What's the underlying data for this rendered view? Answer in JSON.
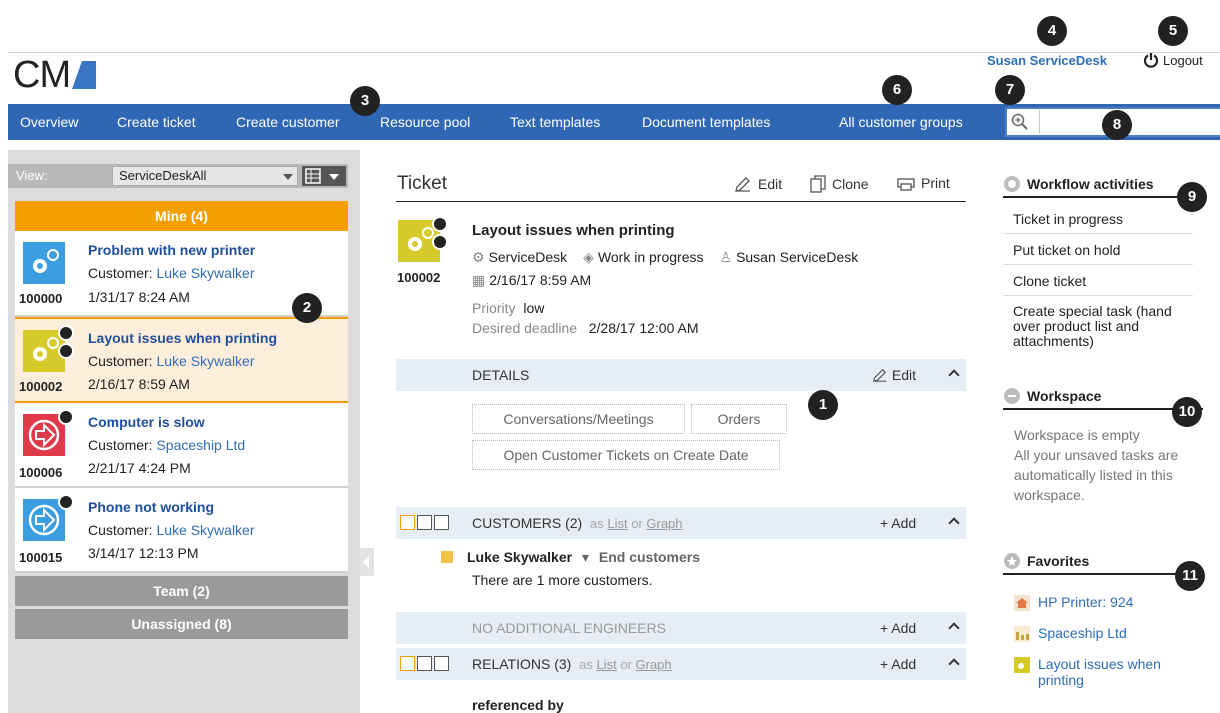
{
  "app": {
    "logo_text": "CM"
  },
  "header": {
    "user_name": "Susan ServiceDesk",
    "logout_label": "Logout"
  },
  "nav": {
    "items": [
      {
        "label": "Overview"
      },
      {
        "label": "Create ticket"
      },
      {
        "label": "Create customer"
      },
      {
        "label": "Resource pool"
      },
      {
        "label": "Text templates"
      },
      {
        "label": "Document templates"
      },
      {
        "label": "All customer groups"
      }
    ],
    "search_value": ""
  },
  "callouts": [
    "1",
    "2",
    "3",
    "4",
    "5",
    "6",
    "7",
    "8",
    "9",
    "10",
    "11"
  ],
  "sidebar": {
    "view_label": "View:",
    "view_value": "ServiceDeskAll",
    "mine_label": "Mine (4)",
    "team_label": "Team (2)",
    "unassigned_label": "Unassigned (8)",
    "customer_prefix": "Customer: ",
    "tickets": [
      {
        "id": "100000",
        "title": "Problem with new printer",
        "customer": "Luke Skywalker",
        "date": "1/31/17 8:24 AM"
      },
      {
        "id": "100002",
        "title": "Layout issues when printing",
        "customer": "Luke Skywalker",
        "date": "2/16/17 8:59 AM"
      },
      {
        "id": "100006",
        "title": "Computer is slow",
        "customer": "Spaceship Ltd",
        "date": "2/21/17 4:24 PM"
      },
      {
        "id": "100015",
        "title": "Phone not working",
        "customer": "Luke Skywalker",
        "date": "3/14/17 12:13 PM"
      }
    ]
  },
  "ticket": {
    "section_title": "Ticket",
    "edit_label": "Edit",
    "clone_label": "Clone",
    "print_label": "Print",
    "id": "100002",
    "title": "Layout issues when printing",
    "group": "ServiceDesk",
    "status": "Work in progress",
    "assignee": "Susan ServiceDesk",
    "created": "2/16/17 8:59 AM",
    "priority_label": "Priority",
    "priority_value": "low",
    "deadline_label": "Desired deadline",
    "deadline_value": "2/28/17 12:00 AM"
  },
  "details": {
    "title": "DETAILS",
    "edit_label": "Edit",
    "chips": [
      "Conversations/Meetings",
      "Orders",
      "Open Customer Tickets on Create Date"
    ]
  },
  "customers": {
    "title": "CUSTOMERS (2)",
    "as": "as",
    "list": "List",
    "or": "or",
    "graph": "Graph",
    "add_label": "+ Add",
    "name": "Luke Skywalker",
    "type": "End customers",
    "more": "There are 1 more customers."
  },
  "engineers": {
    "title": "NO ADDITIONAL ENGINEERS",
    "add_label": "+ Add"
  },
  "relations": {
    "title": "RELATIONS (3)",
    "as": "as",
    "list": "List",
    "or": "or",
    "graph": "Graph",
    "add_label": "+ Add",
    "referenced_by": "referenced by"
  },
  "workflow": {
    "title": "Workflow activities",
    "items": [
      "Ticket in progress",
      "Put ticket on hold",
      "Clone ticket",
      "Create special task (hand over product list and attachments)"
    ]
  },
  "workspace": {
    "title": "Workspace",
    "empty": "Workspace is empty",
    "hint": "All your unsaved tasks are automatically listed in this workspace."
  },
  "favorites": {
    "title": "Favorites",
    "items": [
      "HP Printer: 924",
      "Spaceship Ltd",
      "Layout issues when printing"
    ]
  },
  "colors": {
    "nav_bg": "#3067b5",
    "mine_bar": "#f59e00",
    "link": "#2f6db5"
  }
}
